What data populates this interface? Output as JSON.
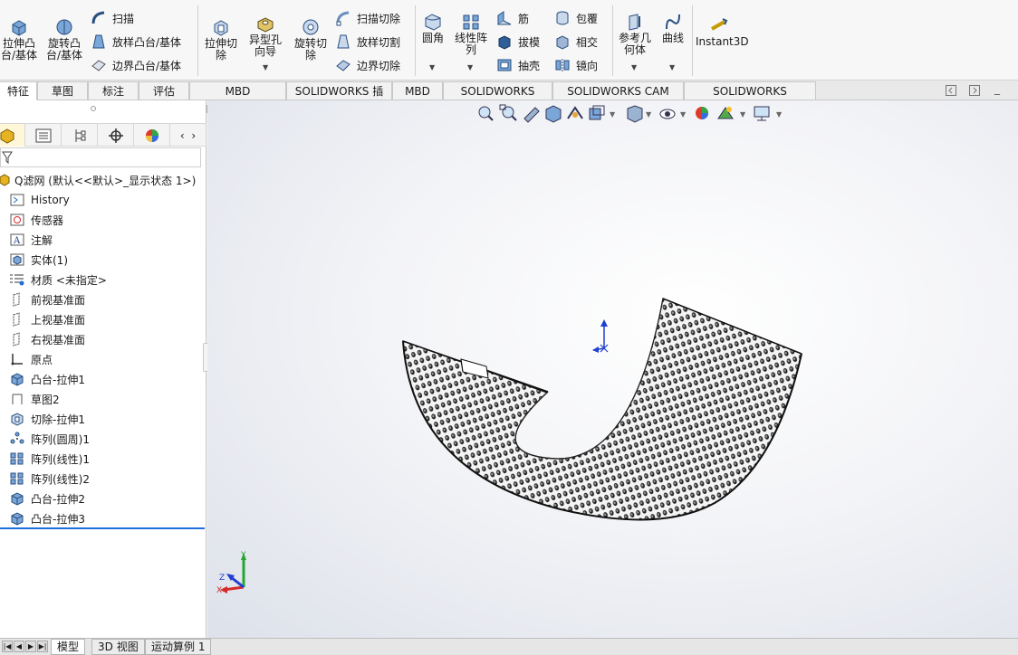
{
  "ribbon": {
    "extrude_boss": "拉伸凸\n台/基体",
    "revolve_boss": "旋转凸\n台/基体",
    "sweep": "扫描",
    "loft_boss": "放样凸台/基体",
    "boundary_boss": "边界凸台/基体",
    "extrude_cut": "拉伸切\n除",
    "hole_wizard": "异型孔\n向导",
    "revolve_cut": "旋转切\n除",
    "sweep_cut": "扫描切除",
    "loft_cut": "放样切割",
    "boundary_cut": "边界切除",
    "fillet": "圆角",
    "linear_pattern": "线性阵\n列",
    "rib": "筋",
    "draft": "拔模",
    "shell": "抽壳",
    "wrap": "包覆",
    "intersect": "相交",
    "mirror": "镜向",
    "ref_geometry": "参考几\n何体",
    "curves": "曲线",
    "instant3d": "Instant3D"
  },
  "tabs": [
    "特征",
    "草图",
    "标注",
    "评估",
    "MBD Dimensions",
    "SOLIDWORKS 插件",
    "MBD",
    "SOLIDWORKS CAM",
    "SOLIDWORKS CAM TBM",
    "SOLIDWORKS Inspection"
  ],
  "tree": {
    "root": "Q滤网 (默认<<默认>_显示状态 1>)",
    "items": [
      "History",
      "传感器",
      "注解",
      "实体(1)",
      "材质 <未指定>",
      "前视基准面",
      "上视基准面",
      "右视基准面",
      "原点",
      "凸台-拉伸1",
      "草图2",
      "切除-拉伸1",
      "阵列(圆周)1",
      "阵列(线性)1",
      "阵列(线性)2",
      "凸台-拉伸2",
      "凸台-拉伸3"
    ]
  },
  "triad": {
    "x": "X",
    "y": "Y",
    "z": "Z"
  },
  "bottom_tabs": [
    "模型",
    "3D 视图",
    "运动算例 1"
  ],
  "colors": {
    "accent": "#1e6fd9",
    "tab_active": "#ffffff"
  }
}
